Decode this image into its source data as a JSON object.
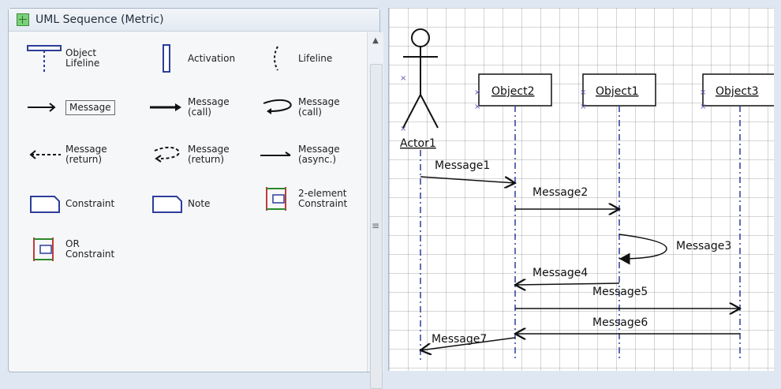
{
  "stencil": {
    "title": "UML Sequence (Metric)",
    "items": [
      {
        "key": "object_lifeline",
        "label": "Object\nLifeline",
        "icon": "object-lifeline-icon"
      },
      {
        "key": "activation",
        "label": "Activation",
        "icon": "activation-icon"
      },
      {
        "key": "lifeline",
        "label": "Lifeline",
        "icon": "lifeline-icon"
      },
      {
        "key": "message",
        "label": "Message",
        "icon": "message-arrow-icon"
      },
      {
        "key": "message_call",
        "label": "Message\n(call)",
        "icon": "message-call-icon"
      },
      {
        "key": "message_call_self",
        "label": "Message\n(call)",
        "icon": "message-call-self-icon"
      },
      {
        "key": "message_return",
        "label": "Message\n(return)",
        "icon": "message-return-icon"
      },
      {
        "key": "message_return_self",
        "label": "Message\n(return)",
        "icon": "message-return-self-icon"
      },
      {
        "key": "message_async",
        "label": "Message\n(async.)",
        "icon": "message-async-icon"
      },
      {
        "key": "constraint",
        "label": "Constraint",
        "icon": "constraint-icon"
      },
      {
        "key": "note",
        "label": "Note",
        "icon": "note-icon"
      },
      {
        "key": "two_element_constraint",
        "label": "2-element\nConstraint",
        "icon": "two-element-constraint-icon"
      },
      {
        "key": "or_constraint",
        "label": "OR\nConstraint",
        "icon": "or-constraint-icon"
      }
    ]
  },
  "diagram": {
    "actor": {
      "label": "Actor1"
    },
    "objects": [
      {
        "label": "Object2"
      },
      {
        "label": "Object1"
      },
      {
        "label": "Object3"
      }
    ],
    "messages": [
      {
        "label": "Message1"
      },
      {
        "label": "Message2"
      },
      {
        "label": "Message3"
      },
      {
        "label": "Message4"
      },
      {
        "label": "Message5"
      },
      {
        "label": "Message6"
      },
      {
        "label": "Message7"
      }
    ]
  },
  "colors": {
    "accent": "#2c3e9a",
    "panel": "#f6f7f9",
    "canvas": "#ffffff"
  }
}
